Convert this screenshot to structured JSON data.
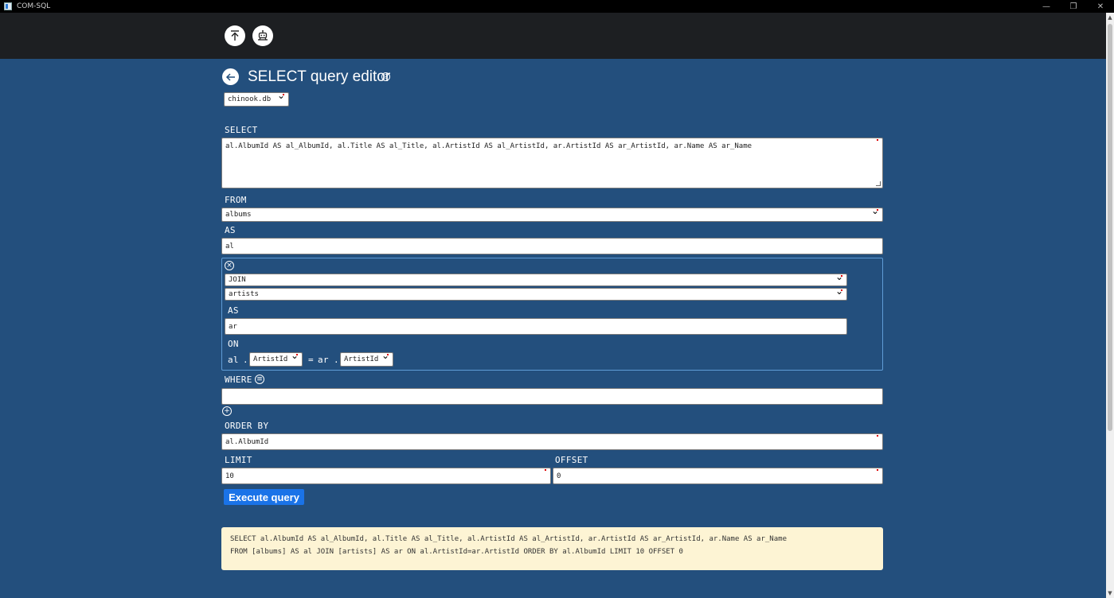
{
  "window": {
    "title": "COM-SQL",
    "controls": {
      "minimize": "—",
      "restore": "❐",
      "close": "✕"
    }
  },
  "page": {
    "title": "SELECT query editor"
  },
  "database": {
    "selected": "chinook.db"
  },
  "select": {
    "label": "SELECT",
    "value": "al.AlbumId AS al_AlbumId, al.Title AS al_Title, al.ArtistId AS al_ArtistId, ar.ArtistId AS ar_ArtistId, ar.Name AS ar_Name"
  },
  "from": {
    "label": "FROM",
    "table": "albums",
    "as_label": "AS",
    "alias": "al"
  },
  "join": {
    "type": "JOIN",
    "table": "artists",
    "as_label": "AS",
    "alias": "ar",
    "on_label": "ON",
    "left_alias": "al",
    "dot": ".",
    "left_column": "ArtistId",
    "equals": "=",
    "right_alias": "ar",
    "right_column": "ArtistId"
  },
  "where": {
    "label": "WHERE",
    "value": ""
  },
  "order_by": {
    "label": "ORDER BY",
    "value": "al.AlbumId"
  },
  "limit": {
    "label": "LIMIT",
    "value": "10"
  },
  "offset": {
    "label": "OFFSET",
    "value": "0"
  },
  "execute": {
    "label": "Execute query"
  },
  "result": {
    "line1": "SELECT al.AlbumId AS al_AlbumId, al.Title AS al_Title, al.ArtistId AS al_ArtistId, ar.ArtistId AS ar_ArtistId, ar.Name AS ar_Name",
    "line2": "FROM [albums] AS al JOIN [artists] AS ar ON al.ArtistId=ar.ArtistId ORDER BY al.AlbumId LIMIT 10 OFFSET 0"
  },
  "colors": {
    "background": "#234f7d",
    "header": "#1d1f22",
    "accent": "#1a73e8",
    "result_bg": "#fdf4d4"
  }
}
